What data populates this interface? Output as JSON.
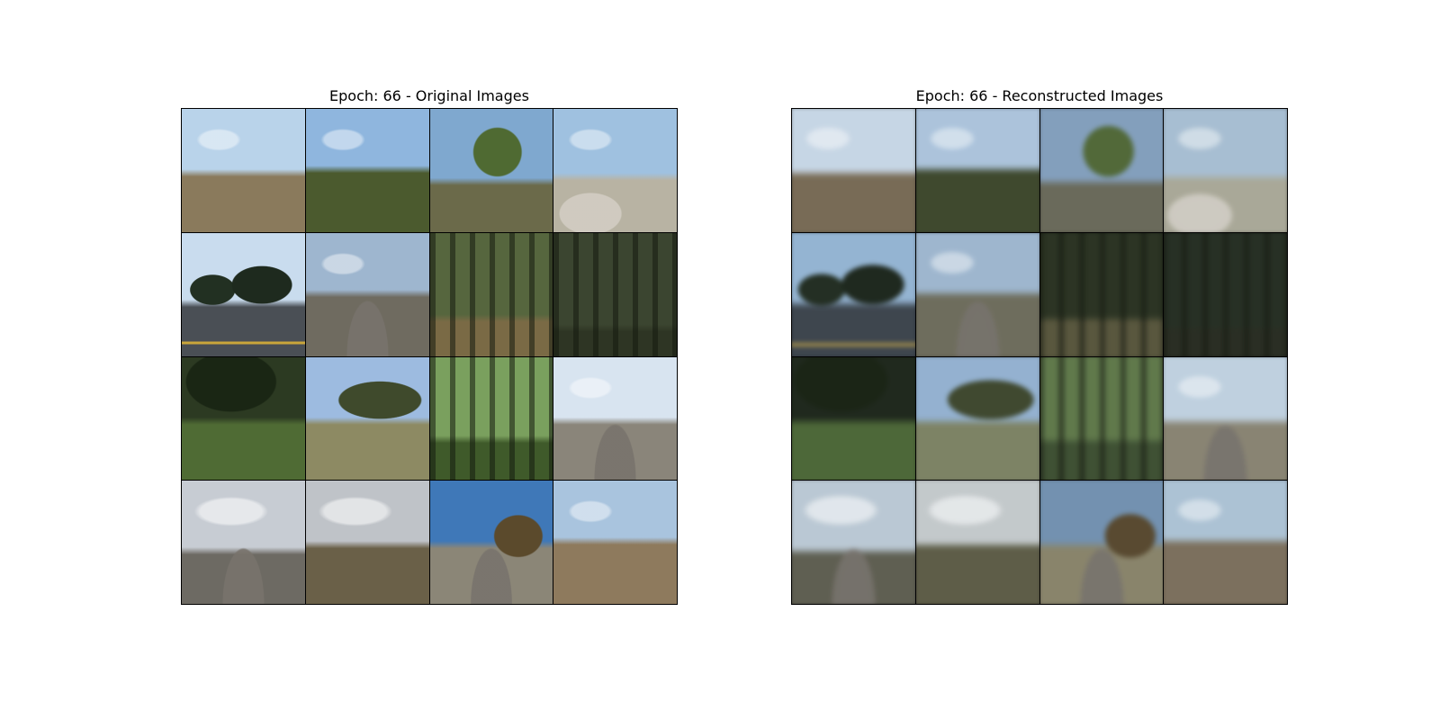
{
  "panels": [
    {
      "id": "original",
      "title": "Epoch: 66 - Original Images",
      "tiles": [
        {
          "scene": "dry-field",
          "sky": "#b9d3ea",
          "ground": "#8a7a5c"
        },
        {
          "scene": "green-bushes",
          "sky": "#8fb6de",
          "ground": "#4b5a2e"
        },
        {
          "scene": "palm-house",
          "sky": "#7fa8cf",
          "ground": "#6b6a4a"
        },
        {
          "scene": "parking-lot",
          "sky": "#9fc1e0",
          "ground": "#b8b3a3"
        },
        {
          "scene": "tree-line-road",
          "sky": "#c9dcee",
          "ground": "#4a4f55"
        },
        {
          "scene": "curved-road",
          "sky": "#9eb6cf",
          "ground": "#6f6b60"
        },
        {
          "scene": "forest",
          "sky": "#56663e",
          "ground": "#7a6a45"
        },
        {
          "scene": "dark-forest",
          "sky": "#3b4530",
          "ground": "#2e3524"
        },
        {
          "scene": "jungle-slope",
          "sky": "#2c3a22",
          "ground": "#4f6b34"
        },
        {
          "scene": "hillside-houses",
          "sky": "#9dbbe0",
          "ground": "#8d8a63"
        },
        {
          "scene": "birch-woods",
          "sky": "#7aa05e",
          "ground": "#3f5a2a"
        },
        {
          "scene": "fisheye-road",
          "sky": "#d8e4f0",
          "ground": "#8a857a"
        },
        {
          "scene": "cloudy-road",
          "sky": "#c7ccd3",
          "ground": "#6d6a63"
        },
        {
          "scene": "overcast-car",
          "sky": "#bfc3c8",
          "ground": "#6a6048"
        },
        {
          "scene": "sunny-road-trees",
          "sky": "#3f78b8",
          "ground": "#8b8677"
        },
        {
          "scene": "dry-plain",
          "sky": "#a9c4de",
          "ground": "#8e7a5d"
        }
      ]
    },
    {
      "id": "reconstructed",
      "title": "Epoch: 66 - Reconstructed Images",
      "tiles": [
        {
          "scene": "dry-field",
          "sky": "#c4d6e8",
          "ground": "#7a6b52"
        },
        {
          "scene": "green-bushes",
          "sky": "#a8c4e0",
          "ground": "#3e4a2a"
        },
        {
          "scene": "palm-house",
          "sky": "#7fa0c2",
          "ground": "#6a6a58"
        },
        {
          "scene": "parking-lot",
          "sky": "#a4bfd6",
          "ground": "#a9a895"
        },
        {
          "scene": "tree-line-road",
          "sky": "#8fb5d8",
          "ground": "#3d4650"
        },
        {
          "scene": "curved-road",
          "sky": "#9ab7d3",
          "ground": "#6e6d5a"
        },
        {
          "scene": "forest",
          "sky": "#2b3522",
          "ground": "#5a573a"
        },
        {
          "scene": "dark-forest",
          "sky": "#263024",
          "ground": "#2a2e22"
        },
        {
          "scene": "jungle-slope",
          "sky": "#1f2a1c",
          "ground": "#4a6a32"
        },
        {
          "scene": "hillside-houses",
          "sky": "#8fb2d6",
          "ground": "#7d8460"
        },
        {
          "scene": "birch-woods",
          "sky": "#5d7a45",
          "ground": "#3d5230"
        },
        {
          "scene": "fisheye-road",
          "sky": "#bcd0e2",
          "ground": "#8a8470"
        },
        {
          "scene": "cloudy-road",
          "sky": "#b8c8d6",
          "ground": "#5f5f50"
        },
        {
          "scene": "overcast-car",
          "sky": "#c2c9cc",
          "ground": "#5e5d45"
        },
        {
          "scene": "sunny-road-trees",
          "sky": "#6e92b6",
          "ground": "#8a8467"
        },
        {
          "scene": "dry-plain",
          "sky": "#a9c3d8",
          "ground": "#7e705a"
        }
      ]
    }
  ]
}
